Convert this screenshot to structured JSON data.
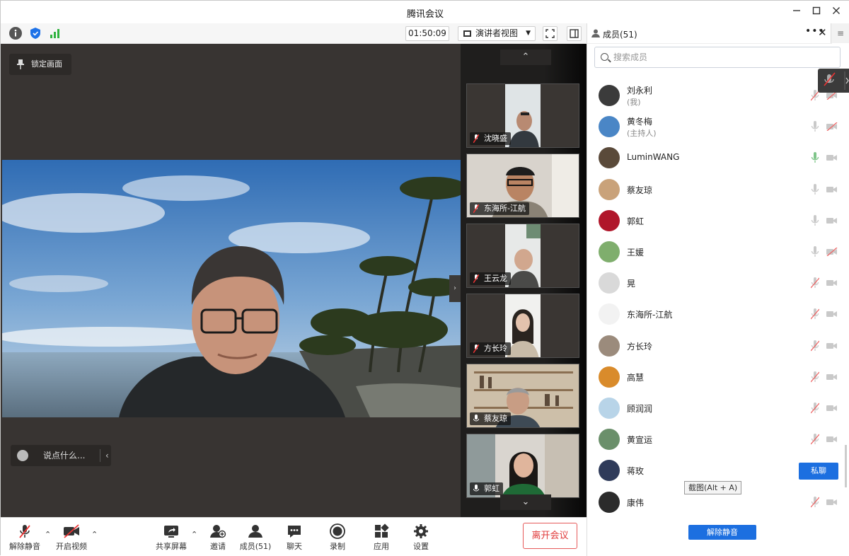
{
  "window": {
    "title": "腾讯会议"
  },
  "toolbar": {
    "timer": "01:50:09",
    "view_mode": "演讲者视图"
  },
  "stage": {
    "lock_label": "锁定画面",
    "chat_placeholder": "说点什么..."
  },
  "thumbnails": [
    {
      "name": "沈晓盛",
      "muted": true
    },
    {
      "name": "东海所-江航",
      "muted": true
    },
    {
      "name": "王云龙",
      "muted": true
    },
    {
      "name": "方长玲",
      "muted": true
    },
    {
      "name": "蔡友琼",
      "muted": false
    },
    {
      "name": "郭虹",
      "muted": false
    }
  ],
  "bottom": {
    "unmute": "解除静音",
    "start_video": "开启视频",
    "share_screen": "共享屏幕",
    "invite": "邀请",
    "members": "成员(51)",
    "chat": "聊天",
    "record": "录制",
    "apps": "应用",
    "settings": "设置",
    "leave": "离开会议"
  },
  "panel": {
    "title": "成员(51)",
    "search_placeholder": "搜索成员",
    "private_chat": "私聊",
    "tooltip": "截图(Alt + A)",
    "unmute_all": "解除静音",
    "members": [
      {
        "name": "刘永利",
        "role": "(我)",
        "mic": "muted",
        "cam": "off",
        "avatar_color": "#3b3b3b"
      },
      {
        "name": "黄冬梅",
        "role": "(主持人)",
        "mic": "on",
        "cam": "off",
        "avatar_color": "#4a86c6"
      },
      {
        "name": "LuminWANG",
        "role": "",
        "mic": "on-green",
        "cam": "on",
        "avatar_color": "#5a4a3a"
      },
      {
        "name": "蔡友琼",
        "role": "",
        "mic": "on",
        "cam": "on",
        "avatar_color": "#c9a27a"
      },
      {
        "name": "郭虹",
        "role": "",
        "mic": "on",
        "cam": "on",
        "avatar_color": "#b0162a"
      },
      {
        "name": "王媛",
        "role": "",
        "mic": "on",
        "cam": "off",
        "avatar_color": "#7fae6d"
      },
      {
        "name": "晃",
        "role": "",
        "mic": "muted",
        "cam": "on",
        "avatar_color": "#d9d9d9"
      },
      {
        "name": "东海所-江航",
        "role": "",
        "mic": "muted",
        "cam": "on",
        "avatar_color": "#f2f2f2"
      },
      {
        "name": "方长玲",
        "role": "",
        "mic": "muted",
        "cam": "on",
        "avatar_color": "#9b8b7c"
      },
      {
        "name": "高慧",
        "role": "",
        "mic": "muted",
        "cam": "on",
        "avatar_color": "#d98b2b"
      },
      {
        "name": "顾润润",
        "role": "",
        "mic": "muted",
        "cam": "on",
        "avatar_color": "#b8d4e8"
      },
      {
        "name": "黄宣运",
        "role": "",
        "mic": "muted",
        "cam": "on",
        "avatar_color": "#6a8f6a"
      },
      {
        "name": "蒋玫",
        "role": "",
        "mic": "none",
        "cam": "none",
        "avatar_color": "#2f3b5a"
      },
      {
        "name": "康伟",
        "role": "",
        "mic": "muted",
        "cam": "on",
        "avatar_color": "#2b2b2b"
      }
    ]
  },
  "colors": {
    "accent": "#1c6fe0",
    "leave": "#e03b3b",
    "stage_bg": "#383432"
  }
}
